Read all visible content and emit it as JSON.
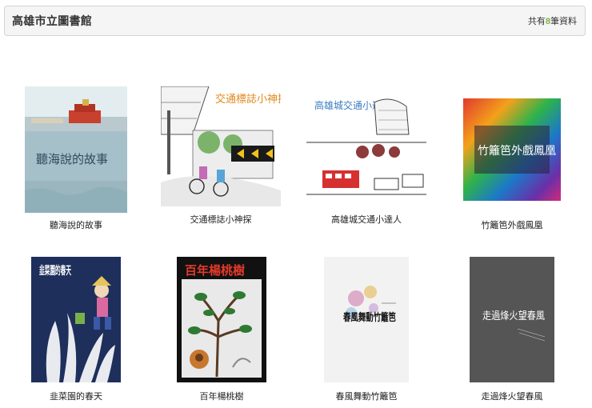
{
  "header": {
    "title": "高雄市立圖書館",
    "count_prefix": "共有",
    "count_value": "8",
    "count_suffix": "筆資料"
  },
  "books": [
    {
      "title": "聽海說的故事",
      "cover_text": "聽海說的故事"
    },
    {
      "title": "交通標誌小神探",
      "cover_text": "交通標誌小神探"
    },
    {
      "title": "高雄城交通小達人",
      "cover_text": "高雄城交通小達人"
    },
    {
      "title": "竹籬笆外戲鳳凰",
      "cover_text": "竹籬笆外戲鳳凰"
    },
    {
      "title": "韭菜園的春天",
      "cover_text": "韭菜園的春天"
    },
    {
      "title": "百年楊桃樹",
      "cover_text": "百年楊桃樹"
    },
    {
      "title": "春風舞動竹籬笆",
      "cover_text": "春風舞動竹籬笆"
    },
    {
      "title": "走過烽火望春風",
      "cover_text": "走過烽火望春風"
    }
  ],
  "colors": {
    "accent_count": "#7cb342",
    "header_bg": "#f5f5f5",
    "header_border": "#d4d4d4"
  }
}
